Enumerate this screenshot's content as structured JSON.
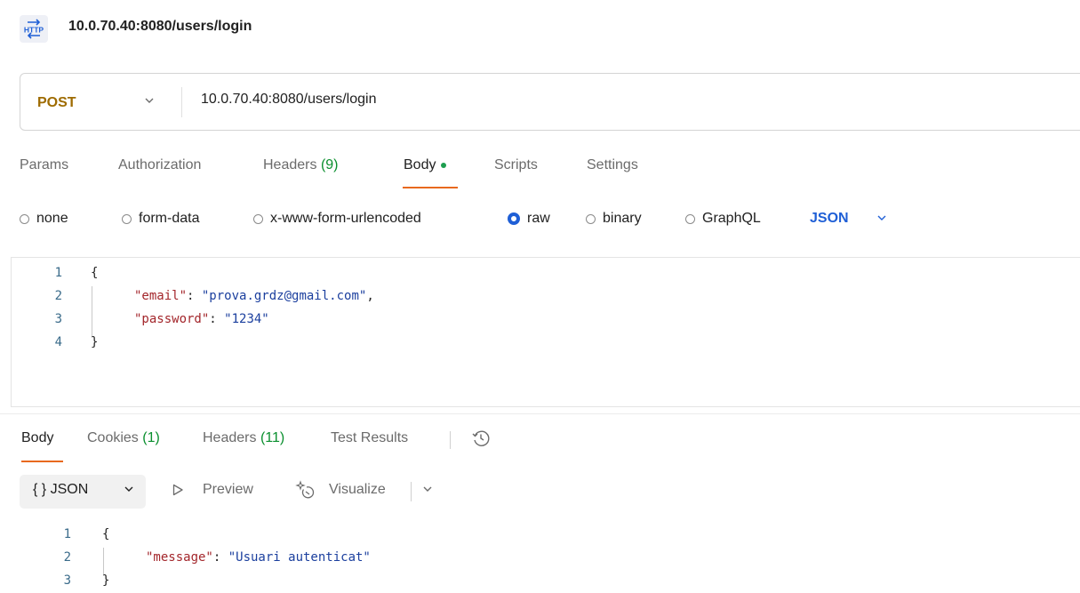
{
  "request": {
    "title": "10.0.70.40:8080/users/login",
    "method": "POST",
    "url": "10.0.70.40:8080/users/login"
  },
  "request_tabs": {
    "params": "Params",
    "authorization": "Authorization",
    "headers": "Headers",
    "headers_count": "(9)",
    "body": "Body",
    "scripts": "Scripts",
    "settings": "Settings"
  },
  "body_types": {
    "none": "none",
    "form_data": "form-data",
    "urlencoded": "x-www-form-urlencoded",
    "raw": "raw",
    "binary": "binary",
    "graphql": "GraphQL",
    "selected": "raw",
    "format": "JSON"
  },
  "request_body": {
    "line_numbers": [
      "1",
      "2",
      "3",
      "4"
    ],
    "open_brace": "{",
    "close_brace": "}",
    "email_key": "\"email\"",
    "email_value": "\"prova.grdz@gmail.com\"",
    "password_key": "\"password\"",
    "password_value": "\"1234\""
  },
  "response_tabs": {
    "body": "Body",
    "cookies": "Cookies",
    "cookies_count": "(1)",
    "headers": "Headers",
    "headers_count": "(11)",
    "test_results": "Test Results"
  },
  "response_toolbar": {
    "format": "{ } JSON",
    "preview": "Preview",
    "visualize": "Visualize"
  },
  "response_body": {
    "line_numbers": [
      "1",
      "2",
      "3"
    ],
    "open_brace": "{",
    "close_brace": "}",
    "message_key": "\"message\"",
    "message_value": "\"Usuari autenticat\""
  },
  "icons": {
    "request_type": "http-icon",
    "history": "history-icon",
    "preview": "play-outline-icon",
    "visualize": "sparkle-icon"
  },
  "colors": {
    "method": "#9e6b00",
    "accent": "#e8691e",
    "count": "#0a8f2e",
    "link_blue": "#1f5fd6"
  }
}
